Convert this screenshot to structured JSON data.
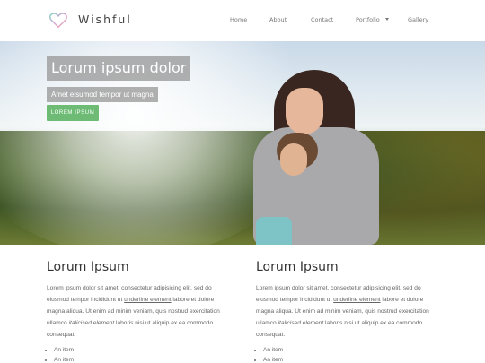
{
  "brand": {
    "name": "Wishful"
  },
  "nav": {
    "items": [
      "Home",
      "About",
      "Contact",
      "Portfolio",
      "Gallery"
    ]
  },
  "hero": {
    "title": "Lorum ipsum dolor",
    "subtitle": "Amet elsumod tempor ut magna",
    "button_label": "LOREM IPSUM"
  },
  "columns": [
    {
      "heading": "Lorum Ipsum",
      "p1": "Lorem ipsum dolor sit amet, consectetur adipisicing elit, sed do elusmod tempor incididunt ut",
      "link": "underline element",
      "p2": "labore et dolore magna aliqua. Ut enim ad minim veniam, quis nostrud exercitation ullamco",
      "em": "italicised element",
      "p3": "laboris nisi ut aliquip ex ea commodo consequat.",
      "list": [
        "An item",
        "An item"
      ]
    },
    {
      "heading": "Lorum Ipsum",
      "p1": "Lorem ipsum dolor sit amet, consectetur adipisicing elit, sed do elusmod tempor incididunt ut",
      "link": "underline element",
      "p2": "labore et dolore magna aliqua. Ut enim ad minim veniam, quis nostrud exercitation ullamco",
      "em": "italicised element",
      "p3": "laboris nisi ut aliquip ex ea commodo consequat.",
      "list": [
        "An item",
        "An item"
      ]
    }
  ],
  "colors": {
    "accent": "#6dbb74",
    "overlay": "#969696"
  }
}
